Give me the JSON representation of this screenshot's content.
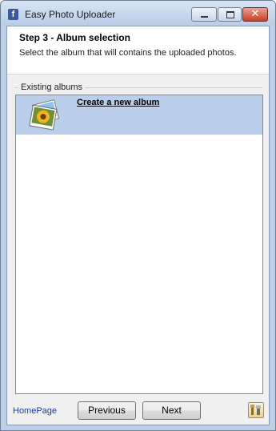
{
  "window": {
    "title": "Easy Photo Uploader",
    "app_icon": "facebook-f-icon",
    "app_icon_glyph": "f",
    "controls": {
      "minimize": "minimize-icon",
      "maximize": "maximize-icon",
      "close": "close-icon",
      "close_glyph": "✕"
    }
  },
  "header": {
    "title": "Step 3 - Album selection",
    "subtitle": "Select the album that will contains the uploaded photos."
  },
  "albums": {
    "group_label": "Existing albums",
    "items": [
      {
        "label": "Create a new album",
        "icon": "photos-icon",
        "selected": true
      }
    ]
  },
  "footer": {
    "homepage_link": "HomePage",
    "previous_label": "Previous",
    "next_label": "Next",
    "tool_icon": "tools-icon"
  },
  "colors": {
    "selection": "#b9cfea",
    "link": "#1e3b9a",
    "titlebar": "#bcd0e9",
    "close_button": "#c73f25"
  }
}
